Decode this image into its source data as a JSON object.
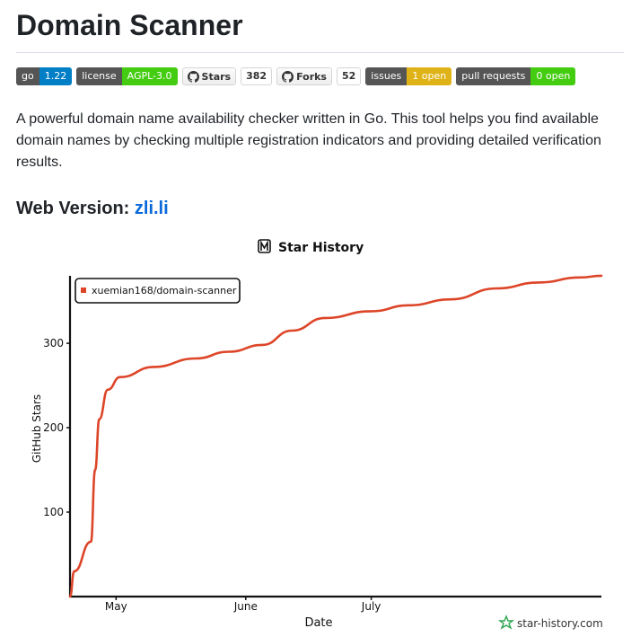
{
  "title": "Domain Scanner",
  "badges": {
    "go": {
      "label": "go",
      "value": "1.22",
      "color": "#007ec6"
    },
    "license": {
      "label": "license",
      "value": "AGPL-3.0",
      "color": "#4c1"
    },
    "stars": {
      "label": "Stars",
      "count": "382"
    },
    "forks": {
      "label": "Forks",
      "count": "52"
    },
    "issues": {
      "label": "issues",
      "value": "1 open",
      "color": "#dfb317"
    },
    "pulls": {
      "label": "pull requests",
      "value": "0 open",
      "color": "#4c1"
    }
  },
  "description": "A powerful domain name availability checker written in Go. This tool helps you find available domain names by checking multiple registration indicators and providing detailed verification results.",
  "web_version": {
    "label": "Web Version:",
    "link_text": "zli.li"
  },
  "chart_data": {
    "type": "line",
    "title": "Star History",
    "xlabel": "Date",
    "ylabel": "GitHub Stars",
    "legend": "top-left",
    "grid": false,
    "x_ticks": [
      "May",
      "June",
      "July"
    ],
    "y_ticks": [
      "100",
      "200",
      "300"
    ],
    "ylim": [
      0,
      382
    ],
    "watermark": "star-history.com",
    "series": [
      {
        "name": "xuemian168/domain-scanner",
        "color": "#dd4528",
        "points": [
          [
            "2025-04-20",
            0
          ],
          [
            "2025-04-21",
            30
          ],
          [
            "2025-04-25",
            65
          ],
          [
            "2025-04-26",
            150
          ],
          [
            "2025-04-27",
            210
          ],
          [
            "2025-04-29",
            245
          ],
          [
            "2025-05-02",
            260
          ],
          [
            "2025-05-10",
            272
          ],
          [
            "2025-05-20",
            282
          ],
          [
            "2025-05-28",
            290
          ],
          [
            "2025-06-05",
            298
          ],
          [
            "2025-06-12",
            315
          ],
          [
            "2025-06-20",
            330
          ],
          [
            "2025-07-01",
            338
          ],
          [
            "2025-07-10",
            345
          ],
          [
            "2025-07-20",
            352
          ],
          [
            "2025-07-31",
            365
          ],
          [
            "2025-08-10",
            372
          ],
          [
            "2025-08-20",
            378
          ],
          [
            "2025-08-25",
            380
          ]
        ]
      }
    ]
  }
}
